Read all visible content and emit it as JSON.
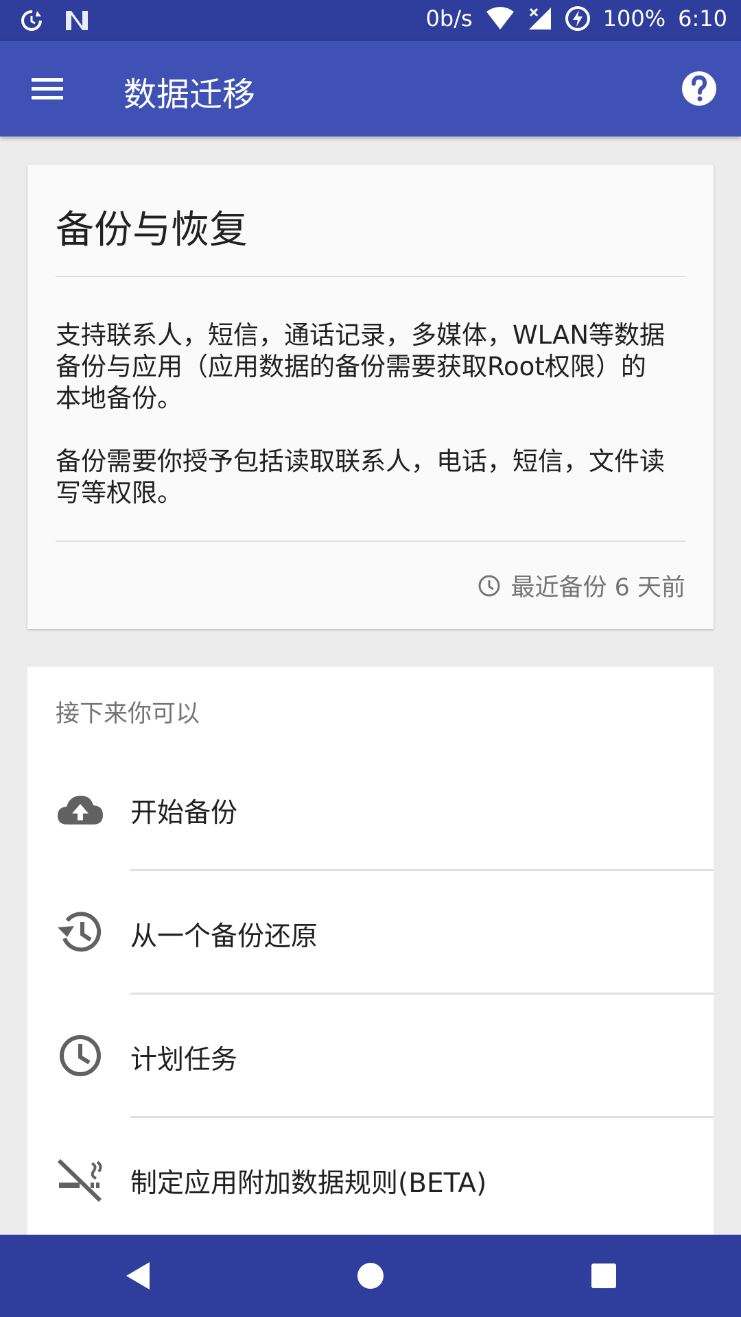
{
  "status_bar": {
    "net_speed": "0b/s",
    "battery": "100%",
    "time": "6:10"
  },
  "app_bar": {
    "title": "数据迁移"
  },
  "card_backup": {
    "title": "备份与恢复",
    "description_1": "支持联系人，短信，通话记录，多媒体，WLAN等数据备份与应用（应用数据的备份需要获取Root权限）的本地备份。",
    "description_2": "备份需要你授予包括读取联系人，电话，短信，文件读写等权限。",
    "last_backup": "最近备份 6 天前"
  },
  "actions": {
    "section_label": "接下来你可以",
    "items": [
      {
        "label": "开始备份",
        "icon": "cloud-upload-icon"
      },
      {
        "label": "从一个备份还原",
        "icon": "history-icon"
      },
      {
        "label": "计划任务",
        "icon": "clock-icon"
      },
      {
        "label": "制定应用附加数据规则(BETA)",
        "icon": "smoke-free-icon"
      }
    ]
  },
  "colors": {
    "status_bar": "#2f3d9c",
    "app_bar": "#3f51b5",
    "background": "#ececec"
  }
}
